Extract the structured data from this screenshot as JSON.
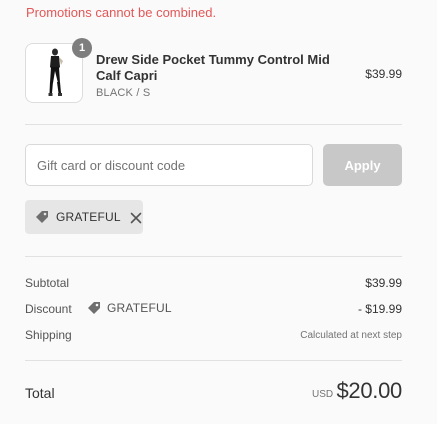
{
  "notice": {
    "promo_error": "Promotions cannot be combined."
  },
  "line_item": {
    "quantity": "1",
    "name": "Drew Side Pocket Tummy Control Mid Calf Capri",
    "variant": "BLACK / S",
    "price": "$39.99",
    "thumbnail_icon": "black-leggings-product-image"
  },
  "discount_entry": {
    "placeholder": "Gift card or discount code",
    "apply_label": "Apply",
    "applied_code": "GRATEFUL",
    "tag_icon": "price-tag-icon",
    "remove_icon": "close-icon"
  },
  "summary": {
    "subtotal_label": "Subtotal",
    "subtotal_value": "$39.99",
    "discount_label": "Discount",
    "discount_code": "GRATEFUL",
    "discount_value": "- $19.99",
    "shipping_label": "Shipping",
    "shipping_value": "Calculated at next step",
    "total_label": "Total",
    "currency": "USD",
    "total_value": "$20.00"
  },
  "colors": {
    "error_text": "#e35757",
    "apply_disabled": "#c8c8c8",
    "tag_background": "#e6e6e6",
    "badge": "#7e7e7e"
  }
}
